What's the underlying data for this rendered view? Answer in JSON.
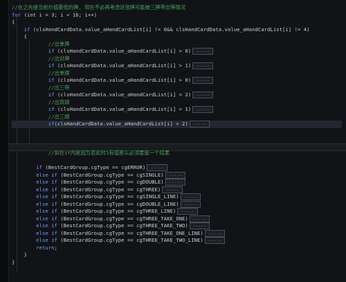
{
  "lines": [
    {
      "cls": "cmt",
      "t": "//在之先接当前价值最低的牌, 现在不必再考虑这张牌可能被三牌带出等情况"
    },
    {
      "cls": "",
      "parts": [
        [
          "kw",
          "for"
        ],
        [
          "txt",
          " (int i = 3; i < 16; i++)"
        ]
      ]
    },
    {
      "cls": "",
      "parts": [
        [
          "txt",
          "{"
        ]
      ]
    },
    {
      "cls": "",
      "parts": [
        [
          "txt",
          "    "
        ],
        [
          "kw",
          "if"
        ],
        [
          "txt",
          " (clsHandCardData.value_aHandCardList[i] != 0&& clsHandCardData.value_aHandCardList[i] != 4)"
        ]
      ]
    },
    {
      "cls": "",
      "parts": [
        [
          "txt",
          "    {"
        ]
      ]
    },
    {
      "cls": "cmt",
      "t": "            //出单牌"
    },
    {
      "cls": "",
      "parts": [
        [
          "txt",
          "            "
        ],
        [
          "kw",
          "if"
        ],
        [
          "txt",
          " (clsHandCardData.value_aHandCardList[i] > 0)"
        ]
      ],
      "box": "....."
    },
    {
      "cls": "cmt",
      "t": "            //出对牌"
    },
    {
      "cls": "",
      "parts": [
        [
          "txt",
          "            "
        ],
        [
          "kw",
          "if"
        ],
        [
          "txt",
          " (clsHandCardData.value_aHandCardList[i] > 1)"
        ]
      ],
      "box": "....."
    },
    {
      "cls": "cmt",
      "t": "            //出单顺"
    },
    {
      "cls": "",
      "parts": [
        [
          "txt",
          "            "
        ],
        [
          "kw",
          "if"
        ],
        [
          "txt",
          " (clsHandCardData.value_aHandCardList[i] > 0)"
        ]
      ],
      "box": "....."
    },
    {
      "cls": "cmt",
      "t": "            //出三带"
    },
    {
      "cls": "",
      "parts": [
        [
          "txt",
          "            "
        ],
        [
          "kw",
          "if"
        ],
        [
          "txt",
          " (clsHandCardData.value_aHandCardList[i] > 2)"
        ]
      ],
      "box": "....."
    },
    {
      "cls": "cmt",
      "t": "            //出双顺"
    },
    {
      "cls": "",
      "parts": [
        [
          "txt",
          "            "
        ],
        [
          "kw",
          "if"
        ],
        [
          "txt",
          " (clsHandCardData.value_aHandCardList[i] > 1)"
        ]
      ],
      "box": "....."
    },
    {
      "cls": "cmt",
      "t": "            //出三顺"
    },
    {
      "cls": "",
      "parts": [
        [
          "txt",
          "            "
        ],
        [
          "kw",
          "if"
        ],
        [
          "txt",
          "(clsHandCardData.value_aHandCardList[i] > 2)"
        ]
      ],
      "box": ".....",
      "sel": true
    },
    {
      "cls": "",
      "parts": [
        [
          "txt",
          " "
        ]
      ]
    },
    {
      "cls": "",
      "parts": [
        [
          "txt",
          " "
        ]
      ]
    },
    {
      "cls": "",
      "parts": [
        [
          "txt",
          " "
        ]
      ]
    },
    {
      "cls": "cmt",
      "t": "            //如在if内是因为若此时1有值那么必须要留一个结果"
    },
    {
      "cls": "",
      "parts": [
        [
          "txt",
          " "
        ]
      ]
    },
    {
      "cls": "",
      "parts": [
        [
          "txt",
          "        "
        ],
        [
          "kw",
          "if"
        ],
        [
          "txt",
          " (BestCardGroup.cgType == cgERROR)"
        ]
      ],
      "box": "....."
    },
    {
      "cls": "",
      "parts": [
        [
          "txt",
          "        "
        ],
        [
          "kw",
          "else if"
        ],
        [
          "txt",
          " (BestCardGroup.cgType == cgSINGLE)"
        ]
      ],
      "box": "....."
    },
    {
      "cls": "",
      "parts": [
        [
          "txt",
          "        "
        ],
        [
          "kw",
          "else if"
        ],
        [
          "txt",
          " (BestCardGroup.cgType == cgDOUBLE)"
        ]
      ],
      "box": "....."
    },
    {
      "cls": "",
      "parts": [
        [
          "txt",
          "        "
        ],
        [
          "kw",
          "else if"
        ],
        [
          "txt",
          " (BestCardGroup.cgType == cgTHREE)"
        ]
      ],
      "box": "....."
    },
    {
      "cls": "",
      "parts": [
        [
          "txt",
          "        "
        ],
        [
          "kw",
          "else if"
        ],
        [
          "txt",
          " (BestCardGroup.cgType == cgSINGLE_LINE)"
        ]
      ],
      "box": "....."
    },
    {
      "cls": "",
      "parts": [
        [
          "txt",
          "        "
        ],
        [
          "kw",
          "else if"
        ],
        [
          "txt",
          " (BestCardGroup.cgType == cgDOUBLE_LINE)"
        ]
      ],
      "box": "....."
    },
    {
      "cls": "",
      "parts": [
        [
          "txt",
          "        "
        ],
        [
          "kw",
          "else if"
        ],
        [
          "txt",
          " (BestCardGroup.cgType == cgTHREE_LINE)"
        ]
      ],
      "box": "....."
    },
    {
      "cls": "",
      "parts": [
        [
          "txt",
          "        "
        ],
        [
          "kw",
          "else if"
        ],
        [
          "txt",
          " (BestCardGroup.cgType == cgTHREE_TAKE_ONE)"
        ]
      ],
      "box": "....."
    },
    {
      "cls": "",
      "parts": [
        [
          "txt",
          "        "
        ],
        [
          "kw",
          "else if"
        ],
        [
          "txt",
          " (BestCardGroup.cgType == cgTHREE_TAKE_TWO)"
        ]
      ],
      "box": "....."
    },
    {
      "cls": "",
      "parts": [
        [
          "txt",
          "        "
        ],
        [
          "kw",
          "else if"
        ],
        [
          "txt",
          " (BestCardGroup.cgType == cgTHREE_TAKE_ONE_LINE)"
        ]
      ],
      "box": "....."
    },
    {
      "cls": "",
      "parts": [
        [
          "txt",
          "        "
        ],
        [
          "kw",
          "else if"
        ],
        [
          "txt",
          " (BestCardGroup.cgType == cgTHREE_TAKE_TWO_LINE)"
        ]
      ],
      "box": "....."
    },
    {
      "cls": "",
      "parts": [
        [
          "txt",
          "        "
        ],
        [
          "kw",
          "return"
        ],
        [
          "txt",
          ";"
        ]
      ]
    },
    {
      "cls": "",
      "parts": [
        [
          "txt",
          "    }"
        ]
      ]
    },
    {
      "cls": "",
      "parts": [
        [
          "txt",
          "}"
        ]
      ]
    }
  ],
  "colors": {
    "background": "#121317",
    "keyword": "#6f9bff",
    "comment": "#4aa35a",
    "text": "#c9ccd3"
  }
}
